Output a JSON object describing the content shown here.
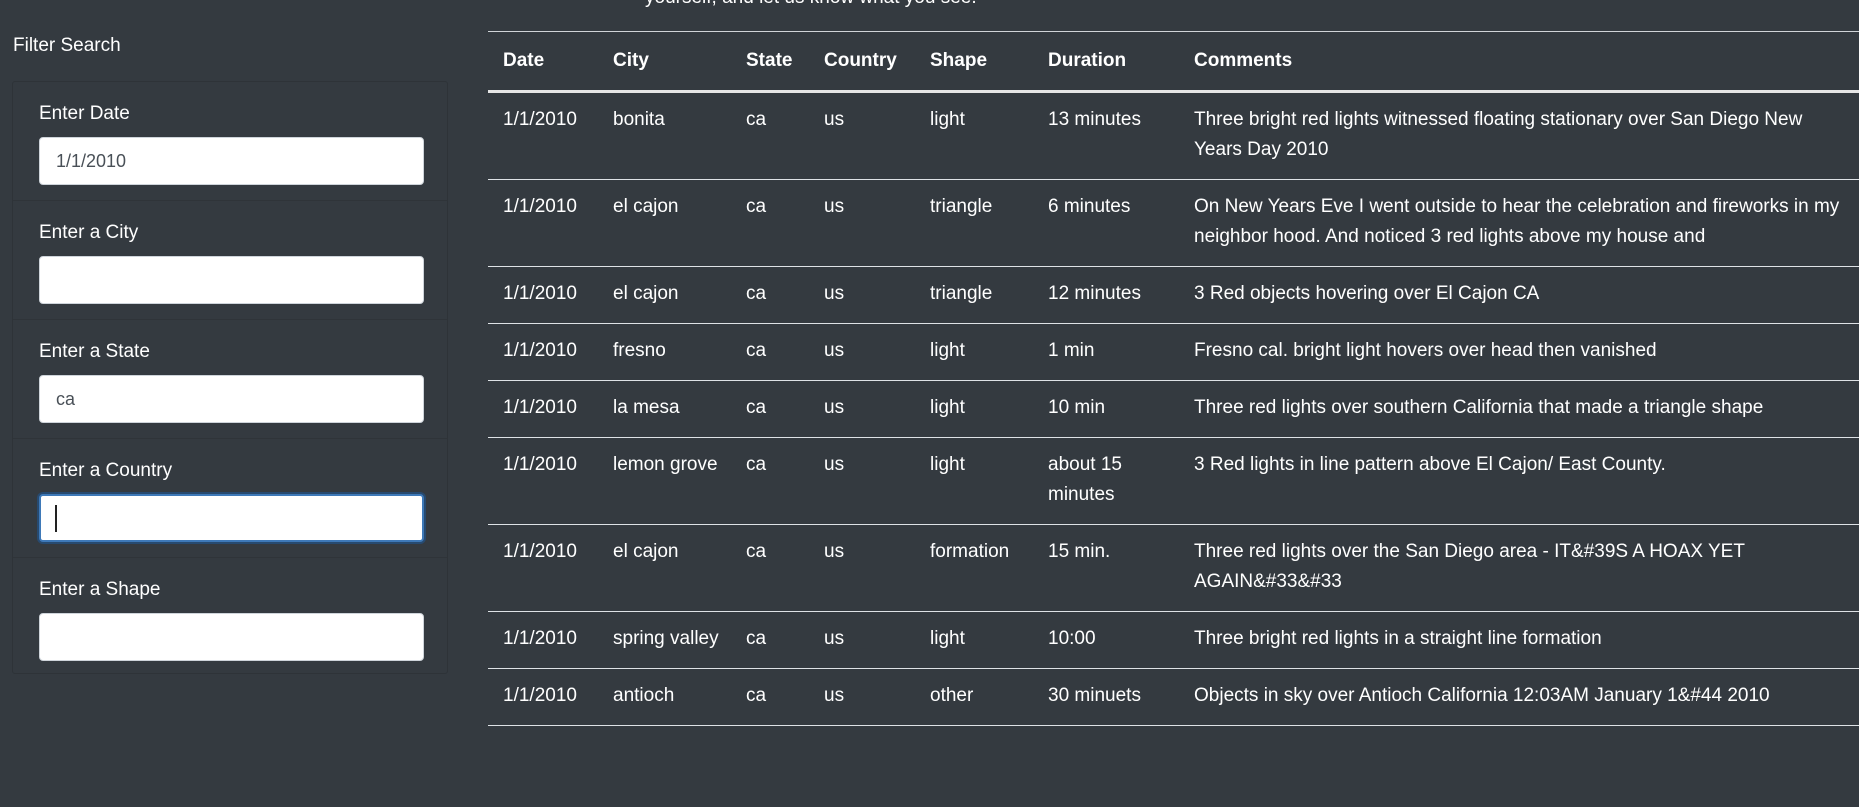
{
  "intro_text_clipped": "yourself, and let us know what you see.",
  "sidebar": {
    "heading": "Filter Search",
    "filters": [
      {
        "label": "Enter Date",
        "value": "1/1/2010",
        "placeholder": ""
      },
      {
        "label": "Enter a City",
        "value": "",
        "placeholder": ""
      },
      {
        "label": "Enter a State",
        "value": "ca",
        "placeholder": ""
      },
      {
        "label": "Enter a Country",
        "value": "",
        "placeholder": ""
      },
      {
        "label": "Enter a Shape",
        "value": "",
        "placeholder": ""
      }
    ]
  },
  "table": {
    "headers": [
      "Date",
      "City",
      "State",
      "Country",
      "Shape",
      "Duration",
      "Comments"
    ],
    "rows": [
      {
        "date": "1/1/2010",
        "city": "bonita",
        "state": "ca",
        "country": "us",
        "shape": "light",
        "duration": "13 minutes",
        "comments": "Three bright red lights witnessed floating stationary over San Diego New Years Day 2010"
      },
      {
        "date": "1/1/2010",
        "city": "el cajon",
        "state": "ca",
        "country": "us",
        "shape": "triangle",
        "duration": "6 minutes",
        "comments": "On New Years Eve I went outside to hear the celebration and fireworks in my neighbor hood. And noticed 3 red lights above my house and"
      },
      {
        "date": "1/1/2010",
        "city": "el cajon",
        "state": "ca",
        "country": "us",
        "shape": "triangle",
        "duration": "12 minutes",
        "comments": "3 Red objects hovering over El Cajon CA"
      },
      {
        "date": "1/1/2010",
        "city": "fresno",
        "state": "ca",
        "country": "us",
        "shape": "light",
        "duration": "1 min",
        "comments": "Fresno cal. bright light hovers over head then vanished"
      },
      {
        "date": "1/1/2010",
        "city": "la mesa",
        "state": "ca",
        "country": "us",
        "shape": "light",
        "duration": "10 min",
        "comments": "Three red lights over southern California that made a triangle shape"
      },
      {
        "date": "1/1/2010",
        "city": "lemon grove",
        "state": "ca",
        "country": "us",
        "shape": "light",
        "duration": "about 15 minutes",
        "comments": "3 Red lights in line pattern above El Cajon/ East County."
      },
      {
        "date": "1/1/2010",
        "city": "el cajon",
        "state": "ca",
        "country": "us",
        "shape": "formation",
        "duration": "15 min.",
        "comments": "Three red lights over the San Diego area - IT&#39S A HOAX YET AGAIN&#33&#33"
      },
      {
        "date": "1/1/2010",
        "city": "spring valley",
        "state": "ca",
        "country": "us",
        "shape": "light",
        "duration": "10:00",
        "comments": "Three bright red lights in a straight line formation"
      },
      {
        "date": "1/1/2010",
        "city": "antioch",
        "state": "ca",
        "country": "us",
        "shape": "other",
        "duration": "30 minuets",
        "comments": "Objects in sky over Antioch California 12:03AM January 1&#44 2010"
      }
    ]
  },
  "colors": {
    "background": "#343a40",
    "text": "#ffffff",
    "input_background": "#ffffff",
    "focus_border": "#3e79b8"
  }
}
